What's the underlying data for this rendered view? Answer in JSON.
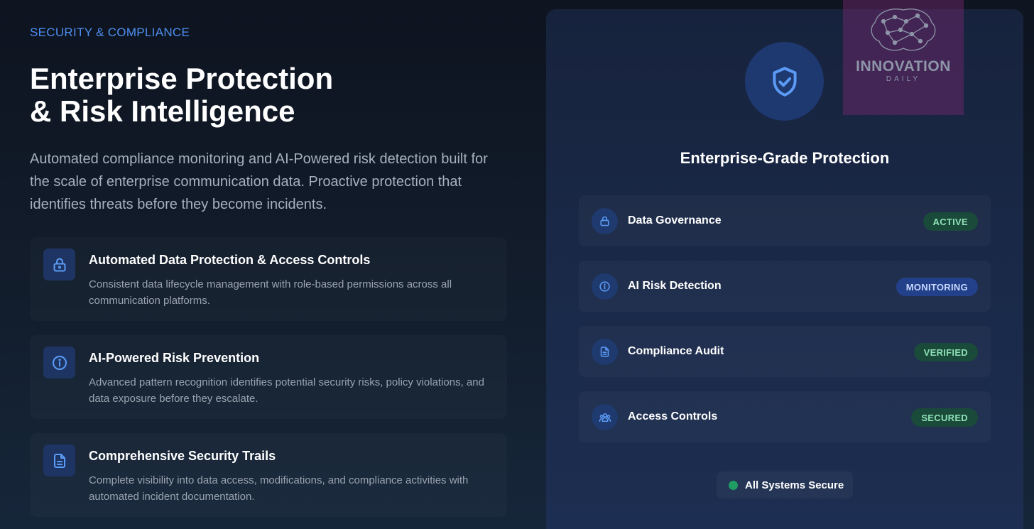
{
  "left": {
    "eyebrow": "SECURITY & COMPLIANCE",
    "headline_line1": "Enterprise Protection",
    "headline_line2": "& Risk Intelligence",
    "lead": "Automated compliance monitoring and AI-Powered risk detection built for the scale of enterprise communication data. Proactive protection that identifies threats before they become incidents.",
    "features": [
      {
        "icon": "lock-icon",
        "title": "Automated Data Protection & Access Controls",
        "description": "Consistent data lifecycle management with role-based permissions across all communication platforms."
      },
      {
        "icon": "info-icon",
        "title": "AI-Powered Risk Prevention",
        "description": "Advanced pattern recognition identifies potential security risks, policy violations, and data exposure before they escalate."
      },
      {
        "icon": "document-icon",
        "title": "Comprehensive Security Trails",
        "description": "Complete visibility into data access, modifications, and compliance activities with automated incident documentation."
      }
    ]
  },
  "panel": {
    "icon": "shield-check-icon",
    "title": "Enterprise-Grade Protection",
    "statuses": [
      {
        "icon": "lock-icon",
        "label": "Data Governance",
        "badge": "ACTIVE",
        "badge_color": "#1a4a3a"
      },
      {
        "icon": "info-icon",
        "label": "AI Risk Detection",
        "badge": "MONITORING",
        "badge_color": "#23418a"
      },
      {
        "icon": "document-icon",
        "label": "Compliance Audit",
        "badge": "VERIFIED",
        "badge_color": "#1a4a3a"
      },
      {
        "icon": "users-icon",
        "label": "Access Controls",
        "badge": "SECURED",
        "badge_color": "#1a4a3a"
      }
    ],
    "footer_status": "All Systems Secure",
    "footer_dot_color": "#1f9d63"
  },
  "watermark": {
    "name": "INNOVATION",
    "sub": "DAILY"
  },
  "colors": {
    "accent": "#4d8ef0",
    "icon_blue": "#5b9bf5"
  }
}
